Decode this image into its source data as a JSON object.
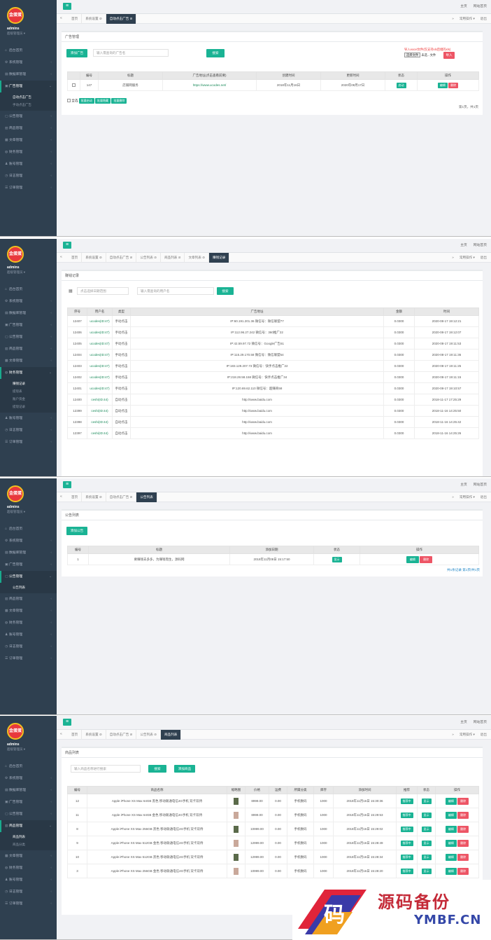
{
  "brand": {
    "logo_text": "金蛋蛋",
    "user": "admins",
    "role": "超级管理员 ▾"
  },
  "topbar": {
    "home": "主页",
    "site_home": "网站首页",
    "tab_ops": "常用操作 ▾",
    "exit": "退出"
  },
  "p1": {
    "menu": [
      "后台首页",
      "系统管理",
      "数据库管理",
      "广告管理",
      "公告管理",
      "商品管理",
      "文章管理",
      "财务管理",
      "账号管理",
      "日志管理",
      "订单管理"
    ],
    "sub": [
      "自动点击广告",
      "手动点击广告"
    ],
    "tabs": [
      "首页",
      "系统设置 ⊘",
      "自动点击广告 ⊘"
    ],
    "box_title": "广告管理",
    "add_btn": "添加广告",
    "search_ph": "输入需查询的广告名",
    "search_btn": "搜索",
    "import_tip": "导入excel文件(仅支持xls后缀的xls)",
    "choose_file": "选择文件",
    "no_file": "未选...文件",
    "import_btn": "导入",
    "headers": [
      "编号",
      "标题",
      "广告地址(点击查看前要)",
      "创建时间",
      "更新时间",
      "状态",
      "操作"
    ],
    "rows": [
      {
        "id": "147",
        "title": "店铺网服务",
        "url": "https://www.ucodes.net/",
        "created": "2018年11月16日",
        "updated": "2020年08月17日",
        "status": "启动"
      }
    ],
    "op_edit": "编辑",
    "op_del": "删除",
    "select_all": "全选",
    "bulk": [
      "批量启动",
      "批量隐藏",
      "批量删除"
    ],
    "pager": "第1页，共1页"
  },
  "p2": {
    "menu": [
      "后台首页",
      "系统管理",
      "数据库管理",
      "广告管理",
      "公告管理",
      "商品管理",
      "文章管理",
      "财务管理",
      "账号管理",
      "日志管理",
      "订单管理"
    ],
    "sub": [
      "赚钱记录",
      "提现表",
      "账户资金",
      "提现记录"
    ],
    "tabs": [
      "首页",
      "系统设置 ⊘",
      "自动点击广告 ⊘",
      "公告列表 ⊘",
      "商品列表 ⊘",
      "文章列表 ⊘",
      "赚钱记录"
    ],
    "box_title": "赚钱记录",
    "date_ph": "点击选择日期范围",
    "user_ph": "输入需查询的用户名",
    "search_btn": "搜索",
    "headers": [
      "序号",
      "用户名",
      "类型",
      "广告地址",
      "金额",
      "时间"
    ],
    "rows": [
      {
        "id": "12407",
        "user": "ucodes(ID:47)",
        "type": "手动点击",
        "addr": "IP:60.191.201.36 微信号：微信联盟77",
        "amt": "0.0300",
        "time": "2020-08-17 19:12:21"
      },
      {
        "id": "12406",
        "user": "ucodes(ID:47)",
        "type": "手动点击",
        "addr": "IP:112.96.27.242 微信号：360推广22",
        "amt": "0.0300",
        "time": "2020-08-17 19:12:07"
      },
      {
        "id": "12405",
        "user": "ucodes(ID:47)",
        "type": "手动点击",
        "addr": "IP:42.59.97.72 微信号：Google广告61",
        "amt": "0.0300",
        "time": "2020-08-17 19:11:53"
      },
      {
        "id": "12404",
        "user": "ucodes(ID:47)",
        "type": "手动点击",
        "addr": "IP:115.29.170.58 微信号：微信联盟54",
        "amt": "0.0300",
        "time": "2020-08-17 19:11:36"
      },
      {
        "id": "12403",
        "user": "ucodes(ID:47)",
        "type": "手动点击",
        "addr": "IP:183.129.207.73 微信号：快手点击推广22",
        "amt": "0.0300",
        "time": "2020-08-17 19:11:25"
      },
      {
        "id": "12402",
        "user": "ucodes(ID:47)",
        "type": "手动点击",
        "addr": "IP:218.28.58.158 微信号：快手点击推广34",
        "amt": "0.0300",
        "time": "2020-08-17 19:11:15"
      },
      {
        "id": "12401",
        "user": "ucodes(ID:47)",
        "type": "手动点击",
        "addr": "IP:120.69.62.110 微信号：超赚商58",
        "amt": "0.0300",
        "time": "2020-08-17 19:10:57"
      },
      {
        "id": "12400",
        "user": "ceshi(ID:44)",
        "type": "自动点击",
        "addr": "http://www.baidu.com",
        "amt": "0.0300",
        "time": "2018-11-17 17:25:29"
      },
      {
        "id": "12399",
        "user": "ceshi(ID:44)",
        "type": "自动点击",
        "addr": "http://www.baidu.com",
        "amt": "0.0300",
        "time": "2018-11-16 14:25:50"
      },
      {
        "id": "12398",
        "user": "ceshi(ID:44)",
        "type": "自动点击",
        "addr": "http://www.baidu.com",
        "amt": "0.0300",
        "time": "2018-11-16 14:25:42"
      },
      {
        "id": "12397",
        "user": "ceshi(ID:44)",
        "type": "自动点击",
        "addr": "http://www.baidu.com",
        "amt": "0.0300",
        "time": "2018-11-16 14:25:26"
      }
    ]
  },
  "p3": {
    "menu": [
      "后台首页",
      "系统管理",
      "数据库管理",
      "广告管理",
      "公告管理",
      "商品管理",
      "文章管理",
      "财务管理",
      "账号管理",
      "日志管理",
      "订单管理"
    ],
    "sub": [
      "公告列表"
    ],
    "tabs": [
      "首页",
      "系统设置 ⊘",
      "自动点击广告 ⊘",
      "公告列表"
    ],
    "box_title": "公告列表",
    "add_btn": "添加公告",
    "headers": [
      "编号",
      "标题",
      "添加日期",
      "状态",
      "操作"
    ],
    "rows": [
      {
        "id": "1",
        "title": "要赚钱去多多，为赚钱而生，源码网",
        "date": "2018年11月08日 15:17:50",
        "status": "显示"
      }
    ],
    "op_edit": "编辑",
    "op_del": "删除",
    "pager": "共1条记录 第1页/共1页"
  },
  "p4": {
    "menu": [
      "后台首页",
      "系统管理",
      "数据库管理",
      "广告管理",
      "公告管理",
      "商品管理",
      "文章管理",
      "财务管理",
      "账号管理",
      "日志管理",
      "订单管理"
    ],
    "sub": [
      "商品列表",
      "商品分类"
    ],
    "tabs": [
      "首页",
      "系统设置 ⊘",
      "自动点击广告 ⊘",
      "公告列表 ⊘",
      "商品列表"
    ],
    "box_title": "商品列表",
    "search_ph": "输入商品名称进行搜索",
    "search_btn": "搜索",
    "add_btn": "添加商品",
    "headers": [
      "编号",
      "商品名称",
      "缩略图",
      "价格",
      "运费",
      "所属分类",
      "库存",
      "添加时间",
      "推荐",
      "状态",
      "操作"
    ],
    "rows": [
      {
        "id": "12",
        "name": "Apple iPhone XS Max 64GB 黑色 移动联通电信4G手机 双卡双待",
        "price": "8999.00",
        "ship": "0.00",
        "cat": "手机数码",
        "stock": "1000",
        "time": "2018年11月16日 15:30:36",
        "rec": "推荐中",
        "status": "显示"
      },
      {
        "id": "11",
        "name": "Apple iPhone XS Max 64GB 金色 移动联通电信4G手机 双卡双待",
        "price": "8999.00",
        "ship": "0.00",
        "cat": "手机数码",
        "stock": "1000",
        "time": "2018年11月16日 15:29:53",
        "rec": "推荐中",
        "status": "显示"
      },
      {
        "id": "8",
        "name": "Apple iPhone XS Max 256GB 黑色 移动联通电信4G手机 双卡双待",
        "price": "10999.00",
        "ship": "0.00",
        "cat": "手机数码",
        "stock": "1000",
        "time": "2018年11月16日 15:29:02",
        "rec": "推荐中",
        "status": "显示"
      },
      {
        "id": "9",
        "name": "Apple iPhone XS Max 512GB 金色 移动联通电信4G手机 双卡双待",
        "price": "12999.00",
        "ship": "0.00",
        "cat": "手机数码",
        "stock": "1000",
        "time": "2018年11月16日 15:28:49",
        "rec": "推荐中",
        "status": "显示"
      },
      {
        "id": "10",
        "name": "Apple iPhone XS Max 512GB 黑色 移动联通电信4G手机 双卡双待",
        "price": "12999.00",
        "ship": "0.00",
        "cat": "手机数码",
        "stock": "1000",
        "time": "2018年11月16日 15:28:34",
        "rec": "推荐中",
        "status": "显示"
      },
      {
        "id": "3",
        "name": "Apple iPhone XS Max 256GB 金色 移动联通电信4G手机 双卡双待",
        "price": "10999.00",
        "ship": "0.00",
        "cat": "手机数码",
        "stock": "1000",
        "time": "2018年11月16日 15:28:20",
        "rec": "推荐中",
        "status": "显示"
      }
    ],
    "op_edit": "编辑",
    "op_del": "删除"
  },
  "watermark": {
    "cn": "源码备份",
    "en": "YMBF.CN",
    "glyph": "码"
  }
}
